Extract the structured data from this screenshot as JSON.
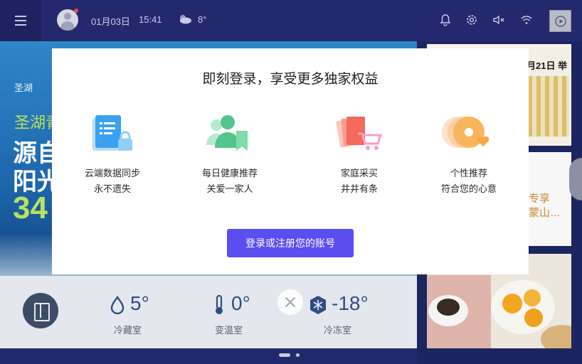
{
  "statusbar": {
    "date": "01月03日",
    "time": "15:41",
    "temperature": "8°",
    "menu_icon": "hamburger-menu-icon",
    "icons": [
      "bell-icon",
      "gear-icon",
      "volume-mute-icon",
      "wifi-icon",
      "play-icon"
    ]
  },
  "background": {
    "banner": {
      "brand": "圣湖",
      "line1": "圣湖青",
      "line2": "源自",
      "line3": "阳光",
      "line4": "34"
    },
    "right_cards": {
      "card_a_text": "月21日 举",
      "card_b_line1": "专享",
      "card_b_line2": "蒙山…"
    },
    "compartments": [
      {
        "value": "5°",
        "label": "冷藏室",
        "icon": "water-drop-icon"
      },
      {
        "value": "0°",
        "label": "变温室",
        "icon": "thermometer-icon"
      },
      {
        "value": "-18°",
        "label": "冷冻室",
        "icon": "snowflake-icon"
      }
    ]
  },
  "modal": {
    "title": "即刻登录，享受更多独家权益",
    "features": [
      {
        "line1": "云端数据同步",
        "line2": "永不遗失",
        "icon": "cloud-document-icon"
      },
      {
        "line1": "每日健康推荐",
        "line2": "关爱一家人",
        "icon": "health-people-icon"
      },
      {
        "line1": "家庭采买",
        "line2": "井井有条",
        "icon": "shopping-cart-icon"
      },
      {
        "line1": "个性推荐",
        "line2": "符合您的心意",
        "icon": "personal-heart-icon"
      }
    ],
    "login_button": "登录或注册您的账号"
  },
  "colors": {
    "accent": "#5b4ef0",
    "statusbar": "#24296e",
    "temperature_text": "#2f4d86"
  }
}
